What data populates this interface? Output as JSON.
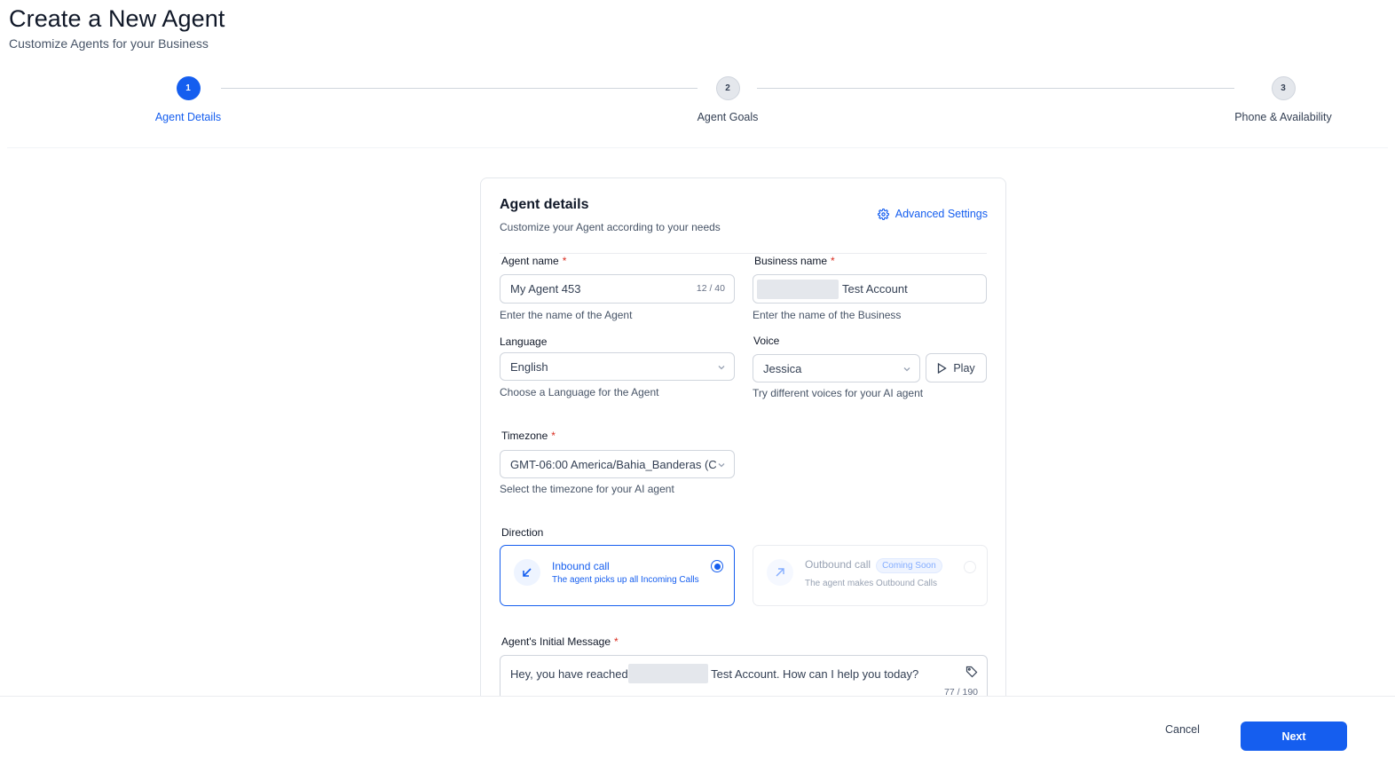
{
  "page": {
    "title": "Create a New Agent",
    "subtitle": "Customize Agents for your Business"
  },
  "stepper": {
    "steps": [
      {
        "number": "1",
        "label": "Agent Details",
        "state": "active"
      },
      {
        "number": "2",
        "label": "Agent Goals",
        "state": "inactive"
      },
      {
        "number": "3",
        "label": "Phone & Availability",
        "state": "inactive"
      }
    ]
  },
  "card": {
    "title": "Agent details",
    "subtitle": "Customize your Agent according to your needs",
    "advanced_settings": "Advanced Settings"
  },
  "form": {
    "agent_name": {
      "label": "Agent name",
      "value": "My Agent 453",
      "counter": "12 / 40",
      "hint": "Enter the name of the Agent"
    },
    "business_name": {
      "label": "Business name",
      "value": "Test Account",
      "hint": "Enter the name of the Business"
    },
    "language": {
      "label": "Language",
      "value": "English",
      "hint": "Choose a Language for the Agent"
    },
    "voice": {
      "label": "Voice",
      "value": "Jessica",
      "play_label": "Play",
      "hint": "Try different voices for your AI agent"
    },
    "timezone": {
      "label": "Timezone",
      "value": "GMT-06:00 America/Bahia_Banderas (C...",
      "hint": "Select the timezone for your AI agent"
    },
    "direction": {
      "label": "Direction",
      "inbound": {
        "title": "Inbound call",
        "desc": "The agent picks up all Incoming Calls",
        "selected": true
      },
      "outbound": {
        "title": "Outbound call",
        "badge": "Coming Soon",
        "desc": "The agent makes Outbound Calls",
        "selected": false
      }
    },
    "initial_message": {
      "label": "Agent's Initial Message",
      "text_before": "Hey, you have reached",
      "text_after": "Test Account. How can I help you today?",
      "counter": "77 / 190"
    },
    "required_mark": "*"
  },
  "footer": {
    "cancel": "Cancel",
    "next": "Next"
  },
  "colors": {
    "accent": "#155eef",
    "required": "#d92d20"
  }
}
